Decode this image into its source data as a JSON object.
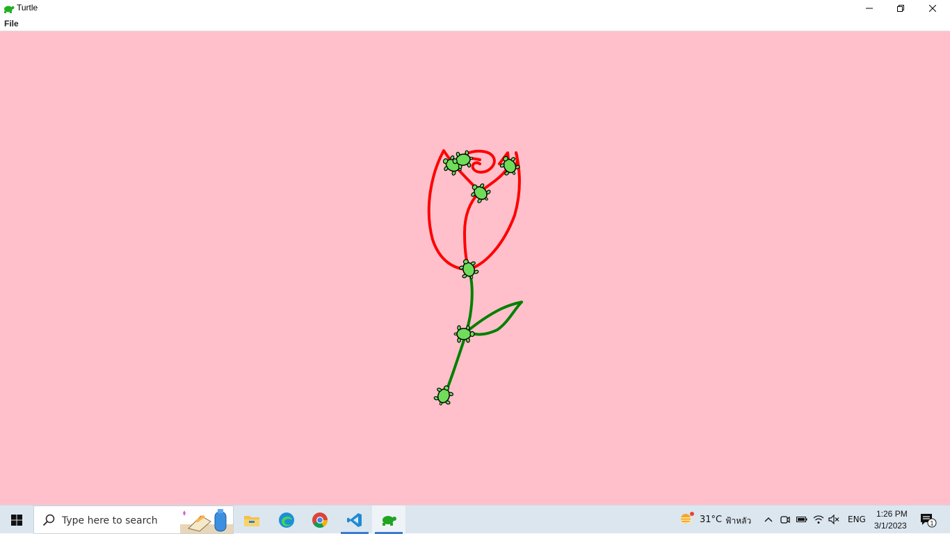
{
  "window": {
    "title": "Turtle",
    "menu": [
      "File"
    ]
  },
  "canvas": {
    "background": "#ffc0cb",
    "rose_color": "#ff0000",
    "stem_color": "#008000",
    "turtle_fill": "#6fdc5a"
  },
  "taskbar": {
    "search_placeholder": "Type here to search",
    "apps": [
      "file-explorer",
      "edge",
      "chrome",
      "vscode",
      "turtle"
    ],
    "active_app": "turtle",
    "weather": {
      "temp": "31°C",
      "desc": "ฟ้าหลัว"
    },
    "language": "ENG",
    "clock": {
      "time": "1:26 PM",
      "date": "3/1/2023"
    },
    "notification_count": "1"
  }
}
